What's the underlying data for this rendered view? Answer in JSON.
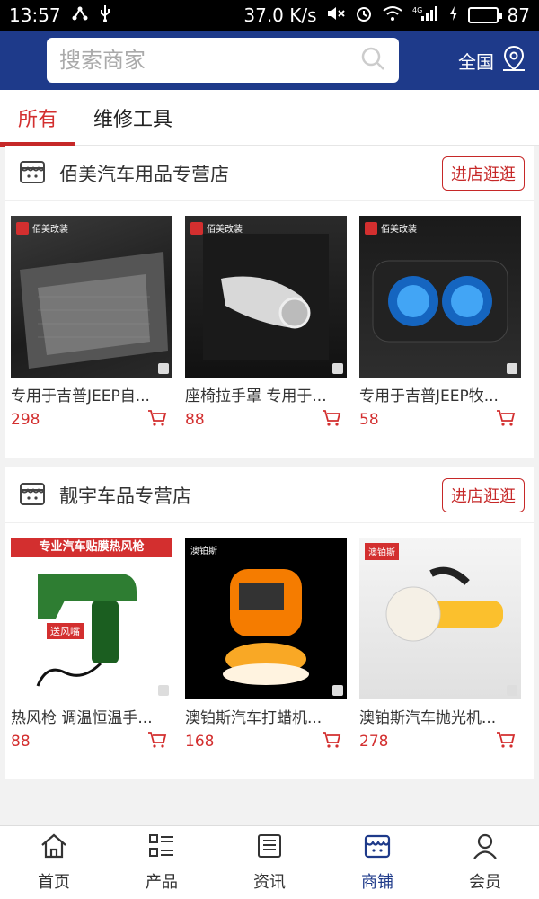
{
  "statusbar": {
    "time": "13:57",
    "speed": "37.0 K/s",
    "network": "4G",
    "battery": "87"
  },
  "header": {
    "search_placeholder": "搜索商家",
    "location": "全国"
  },
  "tabs": [
    {
      "label": "所有",
      "active": true
    },
    {
      "label": "维修工具",
      "active": false
    }
  ],
  "shops": [
    {
      "name": "佰美汽车用品专营店",
      "enter_label": "进店逛逛",
      "products": [
        {
          "name": "专用于吉普JEEP自...",
          "price": "298",
          "badge": "佰美改装"
        },
        {
          "name": "座椅拉手罩 专用于...",
          "price": "88",
          "badge": "佰美改装"
        },
        {
          "name": "专用于吉普JEEP牧...",
          "price": "58",
          "badge": "佰美改装"
        }
      ]
    },
    {
      "name": "靓宇车品专营店",
      "enter_label": "进店逛逛",
      "products": [
        {
          "name": "热风枪 调温恒温手...",
          "price": "88",
          "banner": "专业汽车贴膜热风枪",
          "tag": "送风嘴"
        },
        {
          "name": "澳铂斯汽车打蜡机...",
          "price": "168",
          "badge": "澳铂斯"
        },
        {
          "name": "澳铂斯汽车抛光机...",
          "price": "278",
          "badge": "澳铂斯"
        }
      ]
    }
  ],
  "bottom_nav": [
    {
      "label": "首页",
      "icon": "home-icon",
      "active": false
    },
    {
      "label": "产品",
      "icon": "list-icon",
      "active": false
    },
    {
      "label": "资讯",
      "icon": "news-icon",
      "active": false
    },
    {
      "label": "商铺",
      "icon": "store-icon",
      "active": true
    },
    {
      "label": "会员",
      "icon": "user-icon",
      "active": false
    }
  ],
  "colors": {
    "header_bg": "#1e3a8a",
    "accent_red": "#d32f2f",
    "nav_active": "#1e3a8a"
  }
}
